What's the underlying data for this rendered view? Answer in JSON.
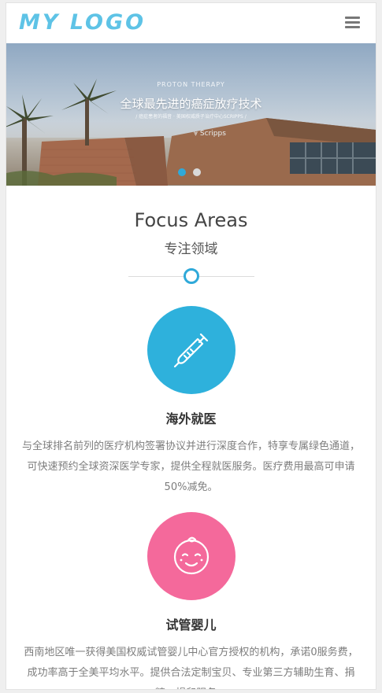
{
  "header": {
    "logo": "MY LOGO",
    "menu_icon": "hamburger-menu-icon"
  },
  "banner": {
    "subtitle": "PROTON THERAPY",
    "headline": "全球最先进的癌症放疗技术",
    "tagline": "/ 癌症患者的福音 · 美国权威质子治疗中心SCRIPPS /",
    "slides_total": 2,
    "active_slide": 1
  },
  "focus": {
    "title": "Focus Areas",
    "subtitle": "专注领域",
    "items": [
      {
        "icon": "thermometer-icon",
        "color": "#2eb1dc",
        "title": "海外就医",
        "desc": "与全球排名前列的医疗机构签署协议并进行深度合作，特享专属绿色通道，可快速预约全球资深医学专家，提供全程就医服务。医疗费用最高可申请50%减免。"
      },
      {
        "icon": "baby-face-icon",
        "color": "#f4699b",
        "title": "试管婴儿",
        "desc": "西南地区唯一获得美国权威试管婴儿中心官方授权的机构，承诺0服务费，成功率高于全美平均水平。提供合法定制宝贝、专业第三方辅助生育、捐精、捐卵服务。"
      }
    ]
  }
}
